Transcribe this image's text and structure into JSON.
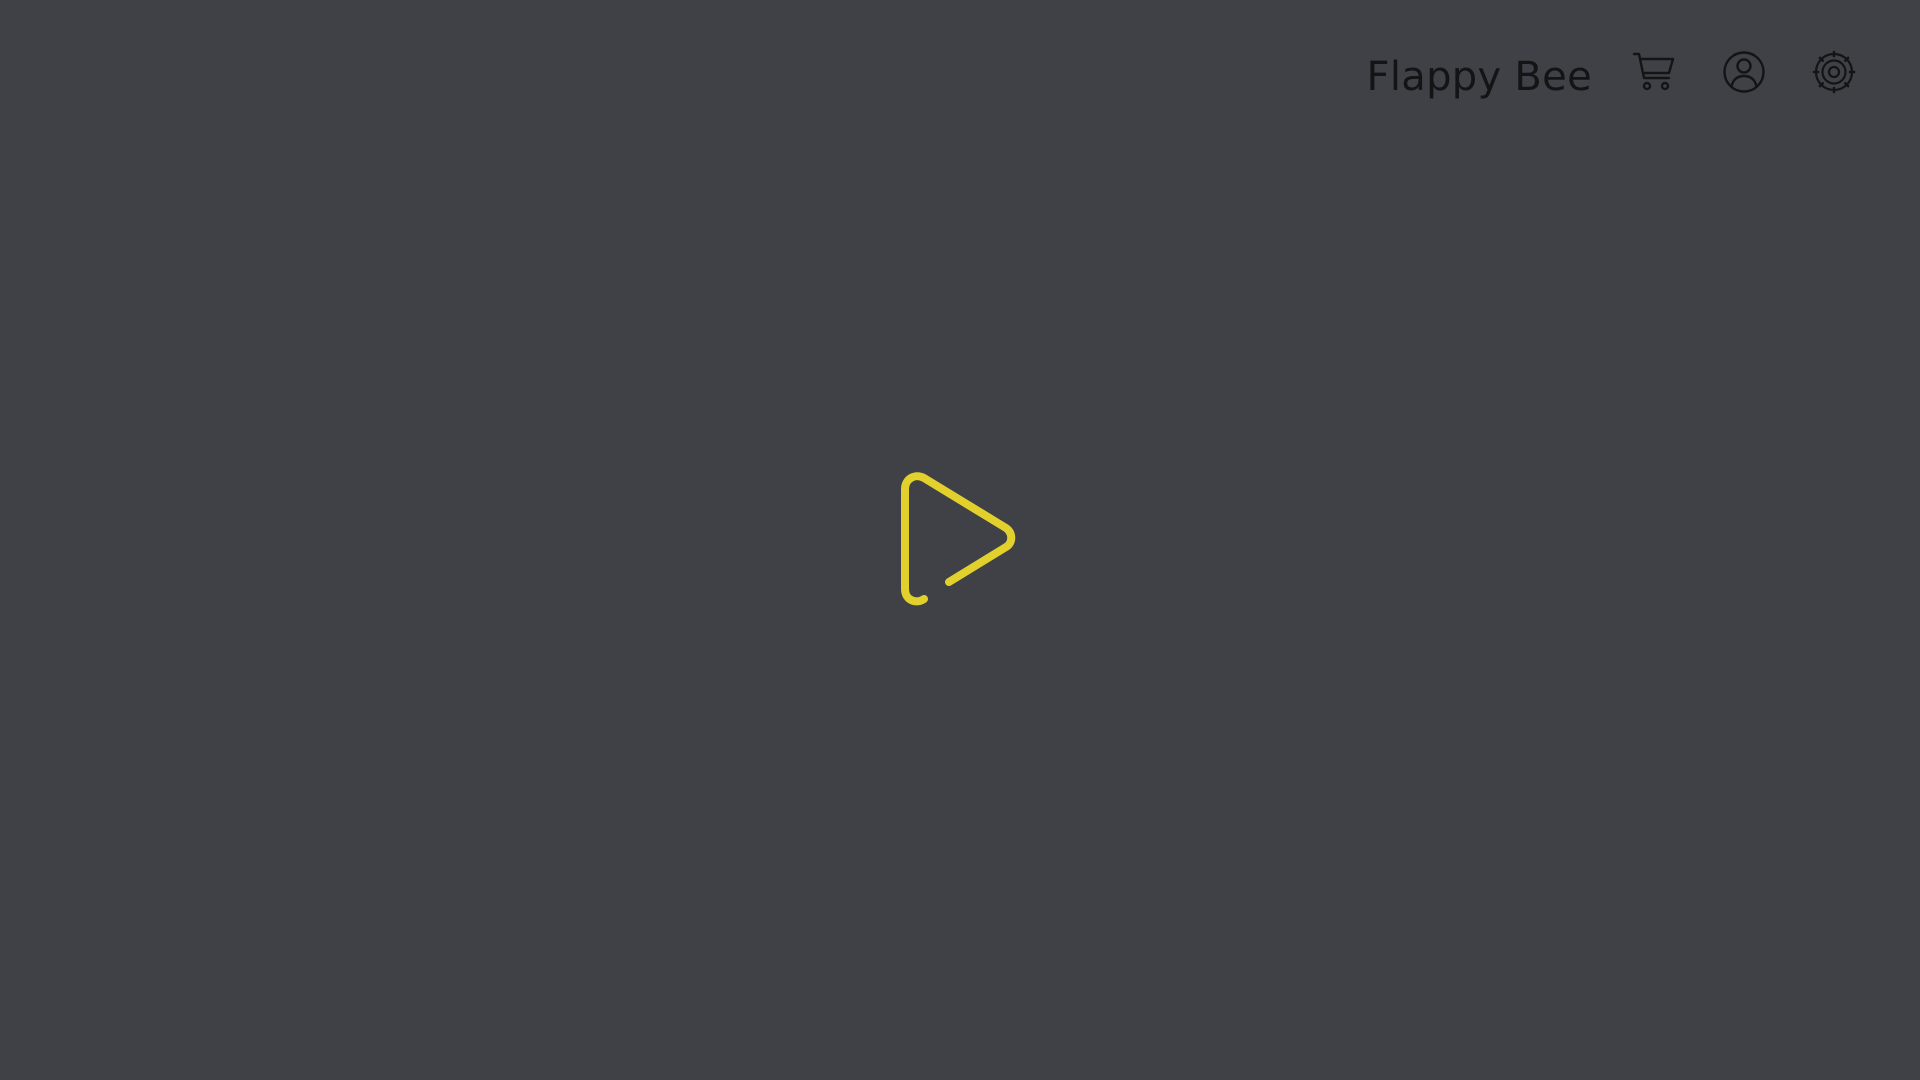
{
  "header": {
    "title": "Flappy Bee"
  },
  "icons": {
    "cart": "cart-icon",
    "profile": "user-icon",
    "settings": "gear-icon",
    "play": "play-icon"
  },
  "colors": {
    "background": "#404146",
    "foreground": "#141416",
    "accent": "#E2D12D"
  }
}
